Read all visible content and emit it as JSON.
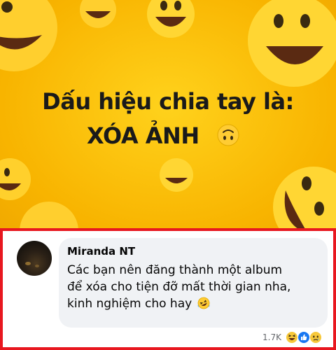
{
  "post_image": {
    "headline_line1": "Dấu hiệu chia tay là:",
    "headline_line2": "XÓA ẢNH",
    "inline_emoji": "upside-down-face-icon",
    "background_color": "#f8b400"
  },
  "comment": {
    "author": "Miranda NT",
    "lines": [
      "Các bạn nên đăng thành một album",
      "để xóa cho tiện đỡ mất thời gian nha,",
      "kinh nghiệm cho hay"
    ],
    "trailing_emoji": "rolling-on-floor-laughing-icon",
    "reaction_count": "1.7K",
    "reactions": [
      "haha-reaction-icon",
      "like-reaction-icon",
      "sad-reaction-icon"
    ],
    "highlight_color": "#e8171f"
  }
}
